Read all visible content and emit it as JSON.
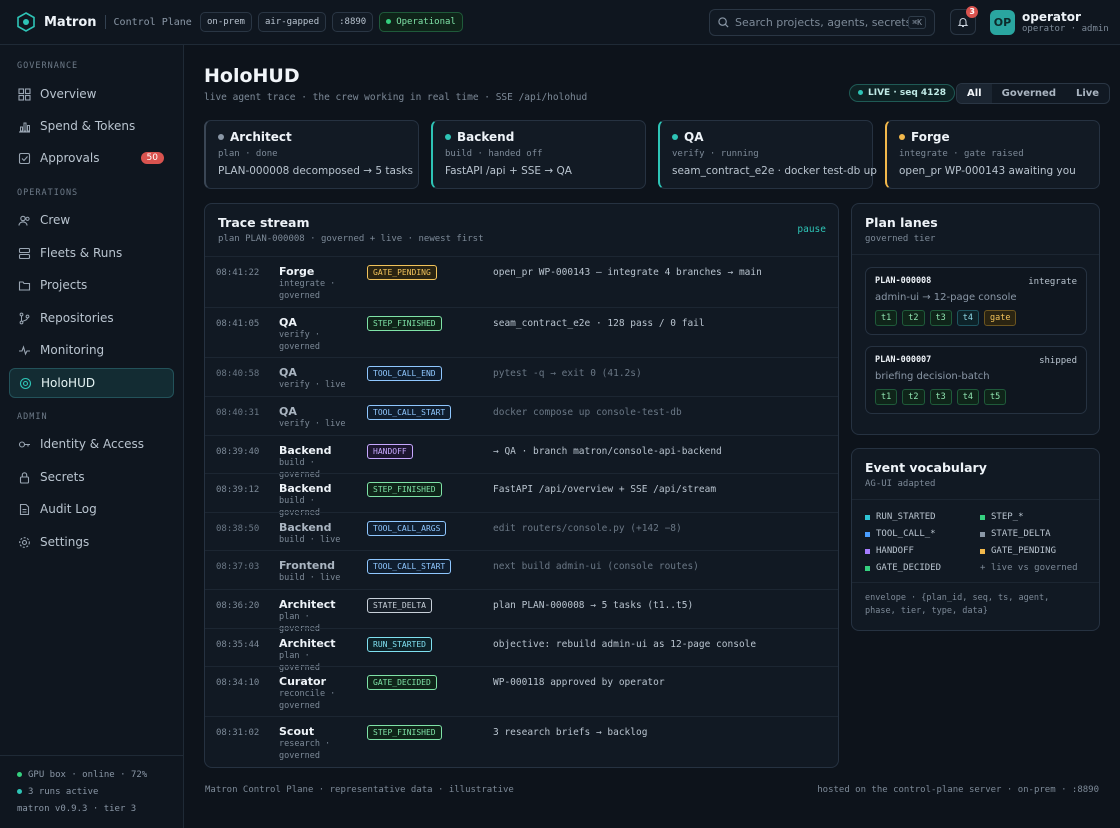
{
  "app": {
    "name": "Matron",
    "subtitle": "Control Plane"
  },
  "topbar": {
    "chips": [
      "on-prem",
      "air-gapped",
      ":8890"
    ],
    "status": "Operational",
    "search_placeholder": "Search projects, agents, secrets...",
    "search_kbd": "⌘K",
    "notifications": "3",
    "user": {
      "initials": "OP",
      "name": "operator",
      "role": "operator · admin"
    }
  },
  "sidebar": {
    "sections": [
      "GOVERNANCE",
      "OPERATIONS",
      "ADMIN"
    ],
    "items": [
      {
        "label": "Overview",
        "icon": "grid-icon"
      },
      {
        "label": "Spend & Tokens",
        "icon": "bar-chart-icon"
      },
      {
        "label": "Approvals",
        "icon": "check-square-icon",
        "count": "50"
      },
      {
        "label": "Crew",
        "icon": "users-icon"
      },
      {
        "label": "Fleets & Runs",
        "icon": "server-icon"
      },
      {
        "label": "Projects",
        "icon": "folder-icon"
      },
      {
        "label": "Repositories",
        "icon": "git-branch-icon"
      },
      {
        "label": "Monitoring",
        "icon": "pulse-icon"
      },
      {
        "label": "HoloHUD",
        "icon": "target-icon",
        "active": true
      },
      {
        "label": "Identity & Access",
        "icon": "key-icon"
      },
      {
        "label": "Secrets",
        "icon": "lock-icon"
      },
      {
        "label": "Audit Log",
        "icon": "document-icon"
      },
      {
        "label": "Settings",
        "icon": "gear-icon"
      }
    ],
    "footer": {
      "gpu": "GPU box · online · 72%",
      "runs": "3 runs active",
      "version": "matron v0.9.3 · tier 3"
    }
  },
  "page": {
    "title": "HoloHUD",
    "subtitle": "live agent trace · the crew working in real time · SSE /api/holohud",
    "live": "LIVE · seq 4128",
    "filters": [
      "All",
      "Governed",
      "Live"
    ],
    "active_filter": "All"
  },
  "agents": [
    {
      "name": "Architect",
      "phase": "plan · done",
      "desc": "PLAN-000008 decomposed → 5 tasks",
      "color": "#8a97a6"
    },
    {
      "name": "Backend",
      "phase": "build · handed off",
      "desc": "FastAPI /api + SSE → QA",
      "color": "#2ec4b6"
    },
    {
      "name": "QA",
      "phase": "verify · running",
      "desc": "seam_contract_e2e · docker test-db up",
      "color": "#2ec4b6"
    },
    {
      "name": "Forge",
      "phase": "integrate · gate raised",
      "desc": "open_pr WP-000143 awaiting you",
      "color": "#f2b84b"
    }
  ],
  "trace": {
    "title": "Trace stream",
    "subtitle": "plan PLAN-000008 · governed + live · newest first",
    "pause": "pause",
    "rows": [
      {
        "ts": "08:41:22",
        "agent": "Forge",
        "phase": "integrate · governed",
        "event": "GATE_PENDING",
        "cls": "ev-gate",
        "msg": "open_pr WP-000143 — integrate 4 branches → main",
        "dim": false
      },
      {
        "ts": "08:41:05",
        "agent": "QA",
        "phase": "verify · governed",
        "event": "STEP_FINISHED",
        "cls": "ev-step",
        "msg": "seam_contract_e2e · 128 pass / 0 fail",
        "dim": false
      },
      {
        "ts": "08:40:58",
        "agent": "QA",
        "phase": "verify · live",
        "event": "TOOL_CALL_END",
        "cls": "ev-tool",
        "msg": "pytest -q → exit 0 (41.2s)",
        "dim": true
      },
      {
        "ts": "08:40:31",
        "agent": "QA",
        "phase": "verify · live",
        "event": "TOOL_CALL_START",
        "cls": "ev-tool",
        "msg": "docker compose up console-test-db",
        "dim": true
      },
      {
        "ts": "08:39:40",
        "agent": "Backend",
        "phase": "build · governed",
        "event": "HANDOFF",
        "cls": "ev-handoff",
        "msg": "→ QA · branch matron/console-api-backend",
        "dim": false
      },
      {
        "ts": "08:39:12",
        "agent": "Backend",
        "phase": "build · governed",
        "event": "STEP_FINISHED",
        "cls": "ev-step",
        "msg": "FastAPI /api/overview + SSE /api/stream",
        "dim": false
      },
      {
        "ts": "08:38:50",
        "agent": "Backend",
        "phase": "build · live",
        "event": "TOOL_CALL_ARGS",
        "cls": "ev-tool",
        "msg": "edit routers/console.py (+142 −8)",
        "dim": true
      },
      {
        "ts": "08:37:03",
        "agent": "Frontend",
        "phase": "build · live",
        "event": "TOOL_CALL_START",
        "cls": "ev-tool",
        "msg": "next build admin-ui (console routes)",
        "dim": true
      },
      {
        "ts": "08:36:20",
        "agent": "Architect",
        "phase": "plan · governed",
        "event": "STATE_DELTA",
        "cls": "ev-state",
        "msg": "plan PLAN-000008 → 5 tasks (t1..t5)",
        "dim": false
      },
      {
        "ts": "08:35:44",
        "agent": "Architect",
        "phase": "plan · governed",
        "event": "RUN_STARTED",
        "cls": "ev-run",
        "msg": "objective: rebuild admin-ui as 12-page console",
        "dim": false
      },
      {
        "ts": "08:34:10",
        "agent": "Curator",
        "phase": "reconcile · governed",
        "event": "GATE_DECIDED",
        "cls": "ev-decided",
        "msg": "WP-000118 approved by operator",
        "dim": false
      },
      {
        "ts": "08:31:02",
        "agent": "Scout",
        "phase": "research · governed",
        "event": "STEP_FINISHED",
        "cls": "ev-step",
        "msg": "3 research briefs → backlog",
        "dim": false
      }
    ]
  },
  "plans": {
    "title": "Plan lanes",
    "subtitle": "governed tier",
    "items": [
      {
        "id": "PLAN-000008",
        "status": "integrate",
        "desc": "admin-ui → 12-page console",
        "tasks": [
          {
            "t": "t1",
            "s": "done"
          },
          {
            "t": "t2",
            "s": "done"
          },
          {
            "t": "t3",
            "s": "done"
          },
          {
            "t": "t4",
            "s": "run"
          },
          {
            "t": "gate",
            "s": "gate"
          }
        ]
      },
      {
        "id": "PLAN-000007",
        "status": "shipped",
        "desc": "briefing decision-batch",
        "tasks": [
          {
            "t": "t1",
            "s": "done"
          },
          {
            "t": "t2",
            "s": "done"
          },
          {
            "t": "t3",
            "s": "done"
          },
          {
            "t": "t4",
            "s": "done"
          },
          {
            "t": "t5",
            "s": "done"
          }
        ]
      }
    ]
  },
  "vocab": {
    "title": "Event vocabulary",
    "subtitle": "AG-UI adapted",
    "items": [
      {
        "label": "RUN_STARTED",
        "color": "#2ec4d6"
      },
      {
        "label": "STEP_*",
        "color": "#35d07f"
      },
      {
        "label": "TOOL_CALL_*",
        "color": "#4a9eff"
      },
      {
        "label": "STATE_DELTA",
        "color": "#8a97a6"
      },
      {
        "label": "HANDOFF",
        "color": "#a57cff"
      },
      {
        "label": "GATE_PENDING",
        "color": "#f2b84b"
      },
      {
        "label": "GATE_DECIDED",
        "color": "#35d07f"
      },
      {
        "label": "+ live vs governed",
        "color": ""
      }
    ],
    "envelope": "envelope · {plan_id, seq, ts, agent, phase, tier, type, data}"
  },
  "footer": {
    "left": "Matron Control Plane · representative data · illustrative",
    "right": "hosted on the control-plane server · on-prem · :8890"
  }
}
